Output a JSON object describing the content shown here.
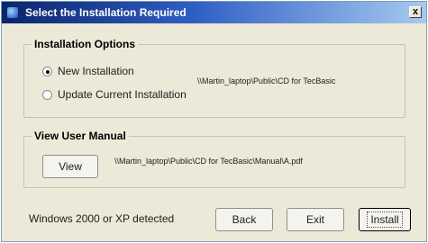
{
  "window": {
    "title": "Select the Installation Required",
    "close_label": "x"
  },
  "installation_options": {
    "legend": "Installation Options",
    "options": [
      {
        "label": "New Installation",
        "selected": true
      },
      {
        "label": "Update Current Installation",
        "selected": false
      }
    ],
    "path": "\\\\Martin_laptop\\Public\\CD for TecBasic"
  },
  "user_manual": {
    "legend": "View User Manual",
    "view_label": "View",
    "path": "\\\\Martin_laptop\\Public\\CD for TecBasic\\Manual\\A.pdf"
  },
  "footer": {
    "status": "Windows 2000 or XP detected",
    "back_label": "Back",
    "exit_label": "Exit",
    "install_label": "Install"
  }
}
